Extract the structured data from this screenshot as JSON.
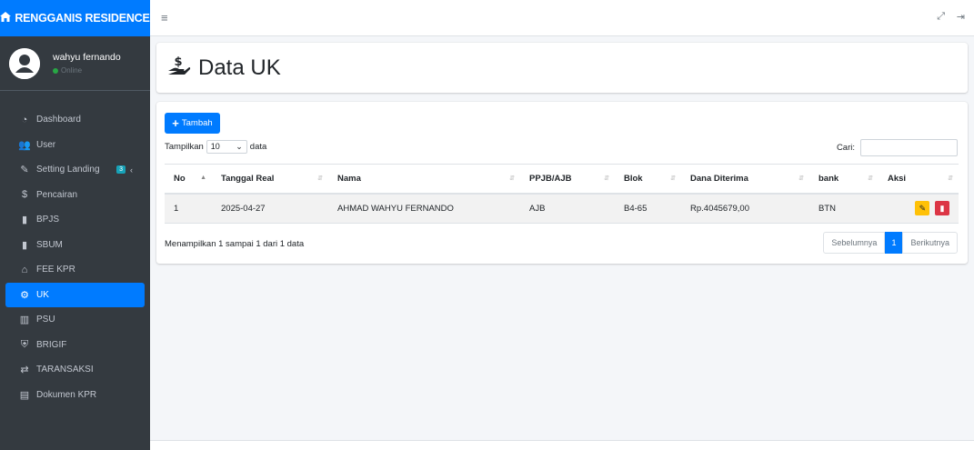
{
  "brand": {
    "name": "RENGGANIS RESIDENCE"
  },
  "user": {
    "name": "wahyu fernando",
    "status": "Online"
  },
  "sidebar": {
    "items": [
      {
        "label": "Dashboard",
        "icon": "tachometer-icon"
      },
      {
        "label": "User",
        "icon": "users-icon"
      },
      {
        "label": "Setting Landing",
        "icon": "edit-icon",
        "badge": "3"
      },
      {
        "label": "Pencairan",
        "icon": "hand-money-icon"
      },
      {
        "label": "BPJS",
        "icon": "file-icon"
      },
      {
        "label": "SBUM",
        "icon": "file-icon"
      },
      {
        "label": "FEE KPR",
        "icon": "house-icon"
      },
      {
        "label": "UK",
        "icon": "cogs-icon",
        "active": true
      },
      {
        "label": "PSU",
        "icon": "building-icon"
      },
      {
        "label": "BRIGIF",
        "icon": "shield-icon"
      },
      {
        "label": "TARANSAKSI",
        "icon": "exchange-icon"
      },
      {
        "label": "Dokumen KPR",
        "icon": "document-icon"
      }
    ]
  },
  "page": {
    "title": "Data UK"
  },
  "toolbar": {
    "add_label": "Tambah"
  },
  "table_controls": {
    "show_prefix": "Tampilkan",
    "page_size": "10",
    "show_suffix": "data",
    "search_label": "Cari:"
  },
  "table": {
    "headers": [
      "No",
      "Tanggal Real",
      "Nama",
      "PPJB/AJB",
      "Blok",
      "Dana Diterima",
      "bank",
      "Aksi"
    ],
    "rows": [
      [
        "1",
        "2025-04-27",
        "AHMAD WAHYU FERNANDO",
        "AJB",
        "B4-65",
        "Rp.4045679,00",
        "BTN"
      ]
    ]
  },
  "footer_info": "Menampilkan 1 sampai 1 dari 1 data",
  "pagination": {
    "prev": "Sebelumnya",
    "current": "1",
    "next": "Berikutnya"
  },
  "colors": {
    "primary": "#007bff",
    "sidebar": "#343a40",
    "warning": "#ffc107",
    "danger": "#dc3545"
  }
}
